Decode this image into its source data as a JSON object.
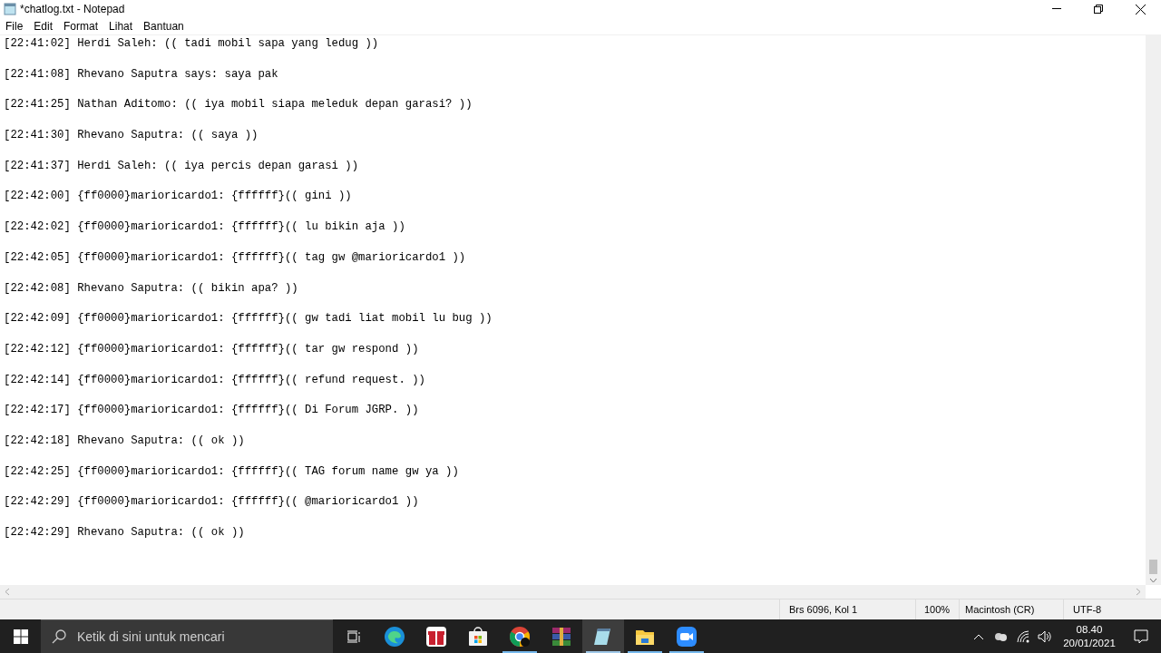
{
  "window": {
    "title": "*chatlog.txt - Notepad"
  },
  "menu": [
    "File",
    "Edit",
    "Format",
    "Lihat",
    "Bantuan"
  ],
  "lines": [
    "[22:41:02] Herdi Saleh: (( tadi mobil sapa yang ledug ))",
    "[22:41:08] Rhevano Saputra says: saya pak",
    "[22:41:25] Nathan Aditomo: (( iya mobil siapa meleduk depan garasi? ))",
    "[22:41:30] Rhevano Saputra: (( saya ))",
    "[22:41:37] Herdi Saleh: (( iya percis depan garasi ))",
    "[22:42:00] {ff0000}marioricardo1: {ffffff}(( gini ))",
    "[22:42:02] {ff0000}marioricardo1: {ffffff}(( lu bikin aja ))",
    "[22:42:05] {ff0000}marioricardo1: {ffffff}(( tag gw @marioricardo1 ))",
    "[22:42:08] Rhevano Saputra: (( bikin apa? ))",
    "[22:42:09] {ff0000}marioricardo1: {ffffff}(( gw tadi liat mobil lu bug ))",
    "[22:42:12] {ff0000}marioricardo1: {ffffff}(( tar gw respond ))",
    "[22:42:14] {ff0000}marioricardo1: {ffffff}(( refund request. ))",
    "[22:42:17] {ff0000}marioricardo1: {ffffff}(( Di Forum JGRP. ))",
    "[22:42:18] Rhevano Saputra: (( ok ))",
    "[22:42:25] {ff0000}marioricardo1: {ffffff}(( TAG forum name gw ya ))",
    "[22:42:29] {ff0000}marioricardo1: {ffffff}(( @marioricardo1 ))",
    "[22:42:29] Rhevano Saputra: (( ok ))"
  ],
  "status_bar": {
    "position": "Brs 6096, Kol 1",
    "zoom": "100%",
    "line_ending": "Macintosh (CR)",
    "encoding": "UTF-8"
  },
  "taskbar": {
    "search": {
      "placeholder": "Ketik di sini untuk mencari"
    },
    "apps": [
      {
        "kind": "edge",
        "running": false,
        "selected": false
      },
      {
        "kind": "gift",
        "running": false,
        "selected": false
      },
      {
        "kind": "store",
        "running": false,
        "selected": false
      },
      {
        "kind": "chrome",
        "running": true,
        "selected": false
      },
      {
        "kind": "archive",
        "running": false,
        "selected": false
      },
      {
        "kind": "notepad",
        "running": true,
        "selected": true
      },
      {
        "kind": "folder",
        "running": true,
        "selected": false
      },
      {
        "kind": "camera",
        "running": true,
        "selected": false
      }
    ],
    "time": "08.40",
    "date": "20/01/2021"
  }
}
